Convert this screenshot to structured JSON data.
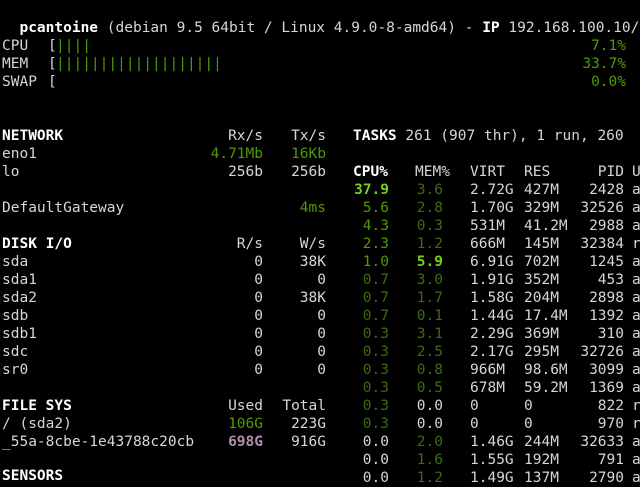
{
  "header": {
    "hostname": "pcantoine",
    "system": "(debian 9.5 64bit / Linux 4.9.0-8-amd64)",
    "separator": "-",
    "ip_label": "IP",
    "ip_value": "192.168.100.10/"
  },
  "quicklook": {
    "cpu": {
      "label": "CPU",
      "bar": "||||",
      "value": "7.1%"
    },
    "mem": {
      "label": "MEM",
      "bar": "|||||||||||||||||||",
      "value": "33.7%"
    },
    "swap": {
      "label": "SWAP",
      "bar": "",
      "value": "0.0%"
    }
  },
  "network": {
    "title": "NETWORK",
    "col_rx": "Rx/s",
    "col_tx": "Tx/s",
    "rows": [
      {
        "name": "eno1",
        "rx": "4.71Mb",
        "tx": "16Kb"
      },
      {
        "name": "lo",
        "rx": "256b",
        "tx": "256b"
      }
    ],
    "gateway": {
      "name": "DefaultGateway",
      "value": "4ms"
    }
  },
  "disk": {
    "title": "DISK I/O",
    "col_r": "R/s",
    "col_w": "W/s",
    "rows": [
      {
        "name": "sda",
        "r": "0",
        "w": "38K"
      },
      {
        "name": "sda1",
        "r": "0",
        "w": "0"
      },
      {
        "name": "sda2",
        "r": "0",
        "w": "38K"
      },
      {
        "name": "sdb",
        "r": "0",
        "w": "0"
      },
      {
        "name": "sdb1",
        "r": "0",
        "w": "0"
      },
      {
        "name": "sdc",
        "r": "0",
        "w": "0"
      },
      {
        "name": "sr0",
        "r": "0",
        "w": "0"
      }
    ]
  },
  "filesys": {
    "title": "FILE SYS",
    "col_used": "Used",
    "col_total": "Total",
    "rows": [
      {
        "name": "/ (sda2)",
        "used": "106G",
        "total": "223G"
      },
      {
        "name": "_55a-8cbe-1e43788c20cb",
        "used": "698G",
        "total": "916G"
      }
    ]
  },
  "sensors": {
    "title": "SENSORS"
  },
  "tasks": {
    "label": "TASKS",
    "summary": "261 (907 thr), 1 run, 260"
  },
  "processes": {
    "headers": {
      "cpu": "CPU%",
      "mem": "MEM%",
      "virt": "VIRT",
      "res": "RES",
      "pid": "PID",
      "user": "U"
    },
    "rows": [
      {
        "cpu": "37.9",
        "mem": "3.6",
        "virt": "2.72G",
        "res": "427M",
        "pid": "2428",
        "user": "a"
      },
      {
        "cpu": "5.6",
        "mem": "2.8",
        "virt": "1.70G",
        "res": "329M",
        "pid": "32526",
        "user": "a"
      },
      {
        "cpu": "4.3",
        "mem": "0.3",
        "virt": "531M",
        "res": "41.2M",
        "pid": "2988",
        "user": "a"
      },
      {
        "cpu": "2.3",
        "mem": "1.2",
        "virt": "666M",
        "res": "145M",
        "pid": "32384",
        "user": "r"
      },
      {
        "cpu": "1.0",
        "mem": "5.9",
        "virt": "6.91G",
        "res": "702M",
        "pid": "1245",
        "user": "a"
      },
      {
        "cpu": "0.7",
        "mem": "3.0",
        "virt": "1.91G",
        "res": "352M",
        "pid": "453",
        "user": "a"
      },
      {
        "cpu": "0.7",
        "mem": "1.7",
        "virt": "1.58G",
        "res": "204M",
        "pid": "2898",
        "user": "a"
      },
      {
        "cpu": "0.7",
        "mem": "0.1",
        "virt": "1.44G",
        "res": "17.4M",
        "pid": "1392",
        "user": "a"
      },
      {
        "cpu": "0.3",
        "mem": "3.1",
        "virt": "2.29G",
        "res": "369M",
        "pid": "310",
        "user": "a"
      },
      {
        "cpu": "0.3",
        "mem": "2.5",
        "virt": "2.17G",
        "res": "295M",
        "pid": "32726",
        "user": "a"
      },
      {
        "cpu": "0.3",
        "mem": "0.8",
        "virt": "966M",
        "res": "98.6M",
        "pid": "3099",
        "user": "a"
      },
      {
        "cpu": "0.3",
        "mem": "0.5",
        "virt": "678M",
        "res": "59.2M",
        "pid": "1369",
        "user": "a"
      },
      {
        "cpu": "0.3",
        "mem": "0.0",
        "virt": "0",
        "res": "0",
        "pid": "822",
        "user": "r"
      },
      {
        "cpu": "0.3",
        "mem": "0.0",
        "virt": "0",
        "res": "0",
        "pid": "970",
        "user": "r"
      },
      {
        "cpu": "0.0",
        "mem": "2.0",
        "virt": "1.46G",
        "res": "244M",
        "pid": "32633",
        "user": "a"
      },
      {
        "cpu": "0.0",
        "mem": "1.6",
        "virt": "1.55G",
        "res": "192M",
        "pid": "791",
        "user": "a"
      },
      {
        "cpu": "0.0",
        "mem": "1.2",
        "virt": "1.49G",
        "res": "137M",
        "pid": "2790",
        "user": "a"
      }
    ]
  }
}
